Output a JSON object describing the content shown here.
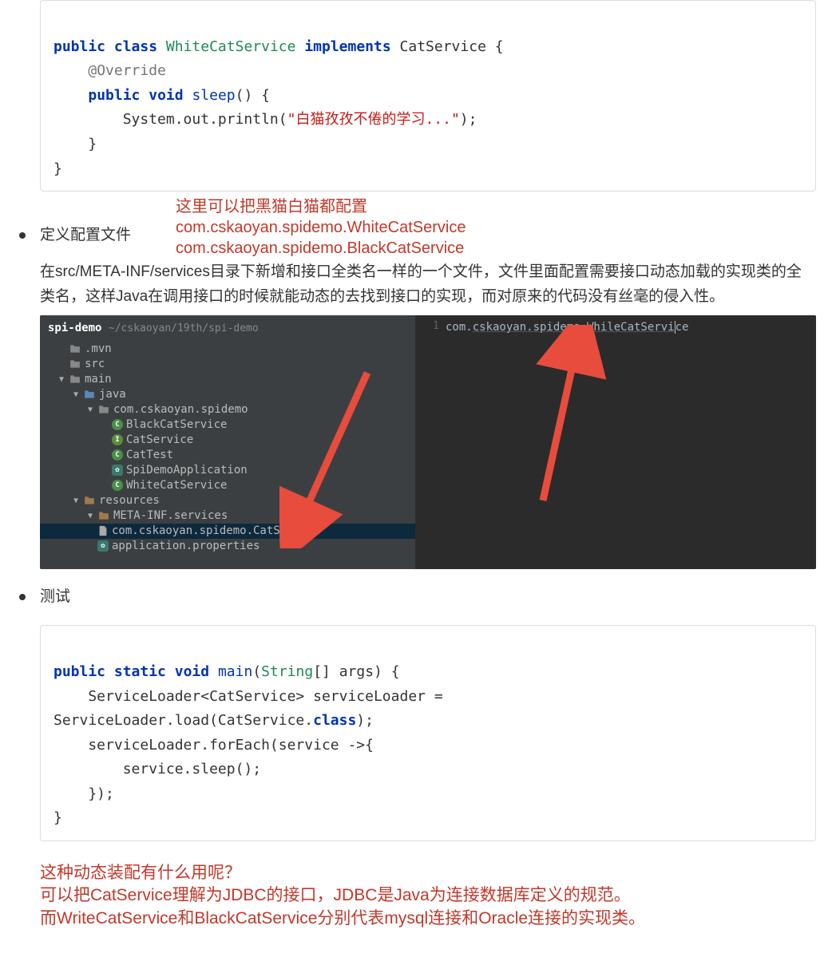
{
  "code1": {
    "l1_public": "public",
    "l1_class": "class",
    "l1_cls": "WhiteCatService",
    "l1_impl": "implements",
    "l1_parent": "CatService",
    "l2_anno": "@Override",
    "l3_public": "public",
    "l3_void": "void",
    "l3_method": "sleep",
    "l4_call": "System.out.println(",
    "l4_str": "\"白猫孜孜不倦的学习...\"",
    "l4_end": ");"
  },
  "anno1": {
    "line1": "这里可以把黑猫白猫都配置",
    "line2": "com.cskaoyan.spidemo.WhiteCatService",
    "line3": "com.cskaoyan.spidemo.BlackCatService"
  },
  "bullet1": "定义配置文件",
  "body1": "在src/META-INF/services目录下新增和接口全类名一样的一个文件，文件里面配置需要接口动态加载的实现类的全类名，这样Java在调用接口的时候就能动态的去找到接口的实现，而对原来的代码没有丝毫的侵入性。",
  "ide": {
    "proj": "spi-demo",
    "path": "~/cskaoyan/19th/spi-demo",
    "tree": {
      "mvn": ".mvn",
      "src": "src",
      "main": "main",
      "java": "java",
      "pkg": "com.cskaoyan.spidemo",
      "c1": "BlackCatService",
      "c2": "CatService",
      "c3": "CatTest",
      "c4": "SpiDemoApplication",
      "c5": "WhiteCatService",
      "res": "resources",
      "meta": "META-INF.services",
      "file": "com.cskaoyan.spidemo.CatService",
      "app": "application.properties"
    },
    "gutter": "1",
    "editor_prefix": "com.",
    "editor_mid": "cskaoyan.spidemo.WhileCatServi",
    "editor_suffix": "ce"
  },
  "bullet2": "测试",
  "code2": {
    "l1_public": "public",
    "l1_static": "static",
    "l1_void": "void",
    "l1_main": "main",
    "l1_string": "String",
    "l1_args": "[] args) {",
    "l2a": "    ServiceLoader<CatService> serviceLoader =",
    "l2b": "ServiceLoader.load(CatService.",
    "l2b_cls": "class",
    "l2b_end": ");",
    "l3": "    serviceLoader.forEach(service ->{",
    "l4": "        service.sleep();",
    "l5": "    });",
    "l6": "}"
  },
  "bottom": {
    "l1": "这种动态装配有什么用呢？",
    "l2": "可以把CatService理解为JDBC的接口，JDBC是Java为连接数据库定义的规范。",
    "l3": "而WriteCatService和BlackCatService分别代表mysql连接和Oracle连接的实现类。"
  }
}
